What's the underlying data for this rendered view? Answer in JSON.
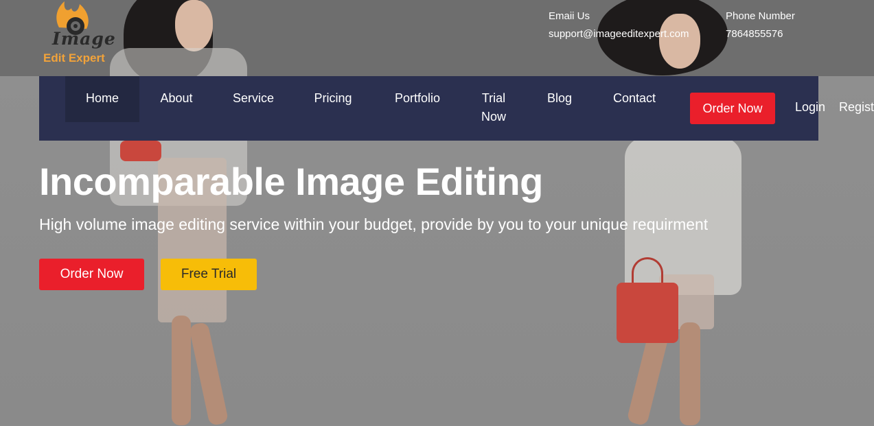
{
  "brand": {
    "word1": "Image",
    "word2": "Edit Expert",
    "accent_color": "#f2a33a"
  },
  "contact": {
    "email_label": "Emaii Us",
    "email_value": "support@imageeditexpert.com",
    "phone_label": "Phone Number",
    "phone_value": "7864855576"
  },
  "nav": {
    "items": [
      {
        "label": "Home"
      },
      {
        "label": "About"
      },
      {
        "label": "Service"
      },
      {
        "label": "Pricing"
      },
      {
        "label": "Portfolio"
      },
      {
        "label": "Trial Now"
      },
      {
        "label": "Blog"
      },
      {
        "label": "Contact"
      }
    ],
    "order_label": "Order Now",
    "login_label": "Login",
    "register_label": "Regist",
    "bar_color": "#2b3050"
  },
  "hero": {
    "headline": "Incomparable Image Editing",
    "subline": "High volume image editing service within your budget, provide by you to your unique requirment",
    "order_label": "Order Now",
    "trial_label": "Free Trial",
    "order_color": "#ea1f2b",
    "trial_color": "#f7bd08"
  },
  "icons": [
    "flame-logo-icon",
    "camera-lens-icon"
  ]
}
